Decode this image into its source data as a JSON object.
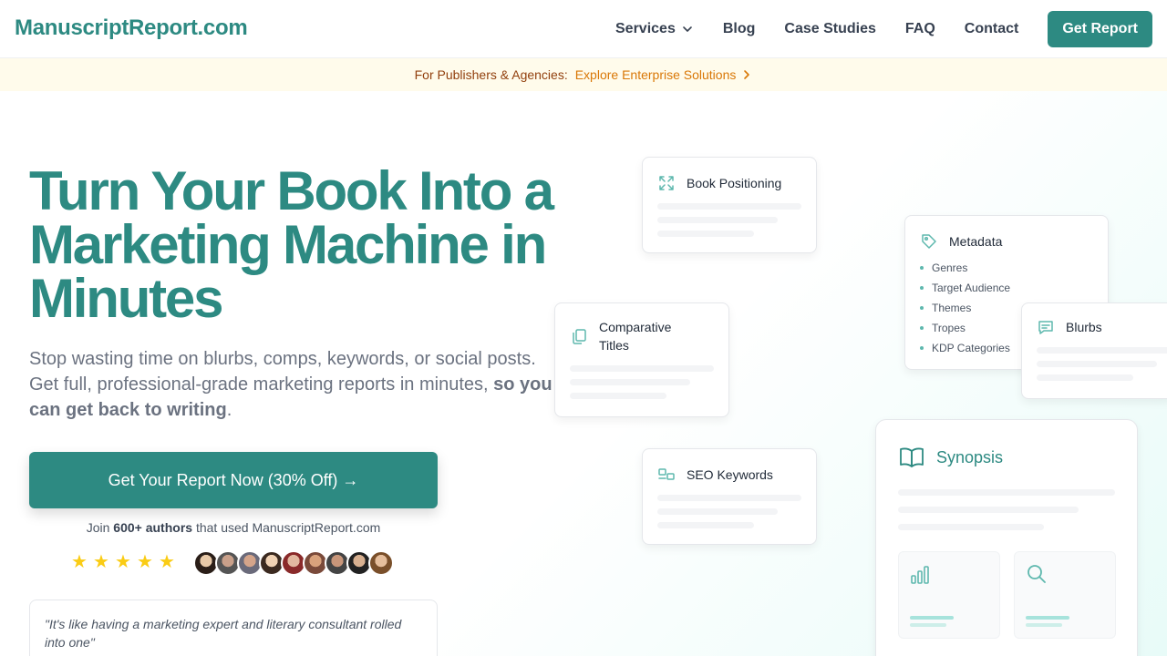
{
  "nav": {
    "logo": "ManuscriptReport.com",
    "links": [
      "Services",
      "Blog",
      "Case Studies",
      "FAQ",
      "Contact"
    ],
    "cta": "Get Report"
  },
  "banner": {
    "label": "For Publishers & Agencies:",
    "link": "Explore Enterprise Solutions"
  },
  "hero": {
    "title": "Turn Your Book Into a Marketing Machine in Minutes",
    "subtitle_plain": "Stop wasting time on blurbs, comps, keywords, or social posts. Get full, professional-grade marketing reports in minutes,",
    "subtitle_bold": "so you can get back to writing",
    "subtitle_end": ".",
    "cta": "Get Your Report Now (30% Off) →",
    "join_prefix": "Join",
    "join_bold": "600+ authors",
    "join_suffix": "that used ManuscriptReport.com",
    "rating_stars": 5,
    "quote": "\"It's like having a marketing expert and literary consultant rolled into one\""
  },
  "cards": {
    "positioning": "Book Positioning",
    "metadata": "Metadata",
    "metadata_items": [
      "Genres",
      "Target Audience",
      "Themes",
      "Tropes",
      "KDP Categories"
    ],
    "comparative": "Comparative Titles",
    "blurbs": "Blurbs",
    "seo": "SEO Keywords",
    "synopsis": "Synopsis"
  },
  "colors": {
    "brand": "#2d8a82",
    "banner_bg": "#fffbeb",
    "banner_link": "#d97706",
    "star": "#facc15"
  }
}
